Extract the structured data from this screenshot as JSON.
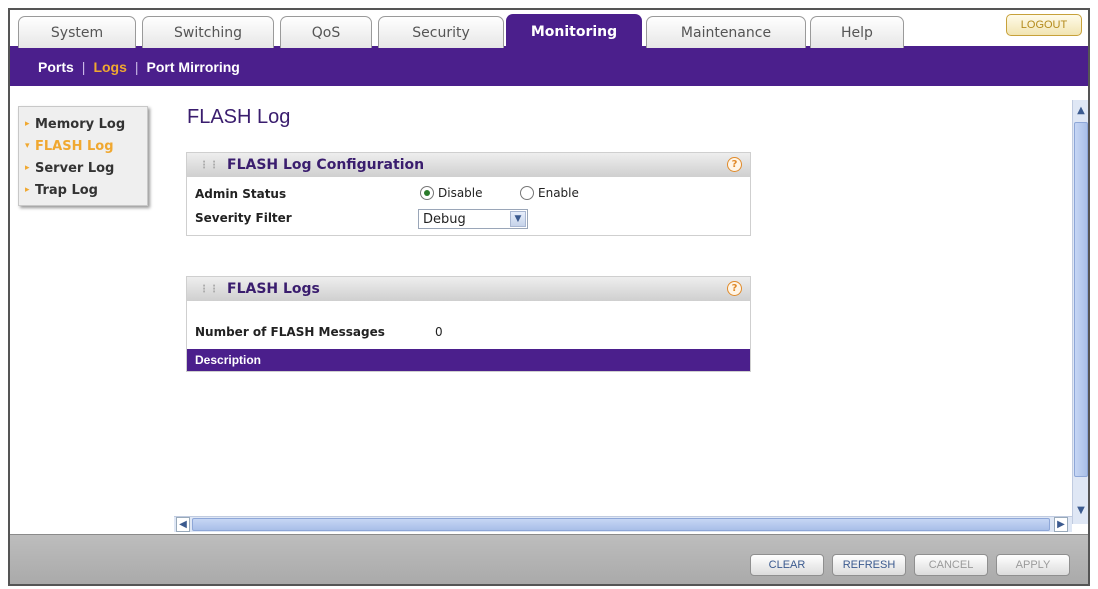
{
  "tabs": [
    {
      "label": "System"
    },
    {
      "label": "Switching"
    },
    {
      "label": "QoS"
    },
    {
      "label": "Security"
    },
    {
      "label": "Monitoring"
    },
    {
      "label": "Maintenance"
    },
    {
      "label": "Help"
    }
  ],
  "active_tab": "Monitoring",
  "logout_label": "LOGOUT",
  "subnav": {
    "items": [
      {
        "label": "Ports"
      },
      {
        "label": "Logs"
      },
      {
        "label": "Port Mirroring"
      }
    ],
    "separator": "|"
  },
  "leftmenu": {
    "items": [
      {
        "label": "Memory Log"
      },
      {
        "label": "FLASH Log"
      },
      {
        "label": "Server Log"
      },
      {
        "label": "Trap Log"
      }
    ]
  },
  "page_title": "FLASH Log",
  "config_panel": {
    "title": "FLASH Log Configuration",
    "admin_status_label": "Admin Status",
    "disable_label": "Disable",
    "enable_label": "Enable",
    "severity_filter_label": "Severity Filter",
    "severity_value": "Debug"
  },
  "logs_panel": {
    "title": "FLASH Logs",
    "count_label": "Number of FLASH Messages",
    "count_value": "0",
    "column_description": "Description"
  },
  "help_glyph": "?",
  "buttons": {
    "clear": "CLEAR",
    "refresh": "REFRESH",
    "cancel": "CANCEL",
    "apply": "APPLY"
  },
  "colors": {
    "brand_purple": "#4b1f8c",
    "accent_orange": "#f0a830"
  }
}
